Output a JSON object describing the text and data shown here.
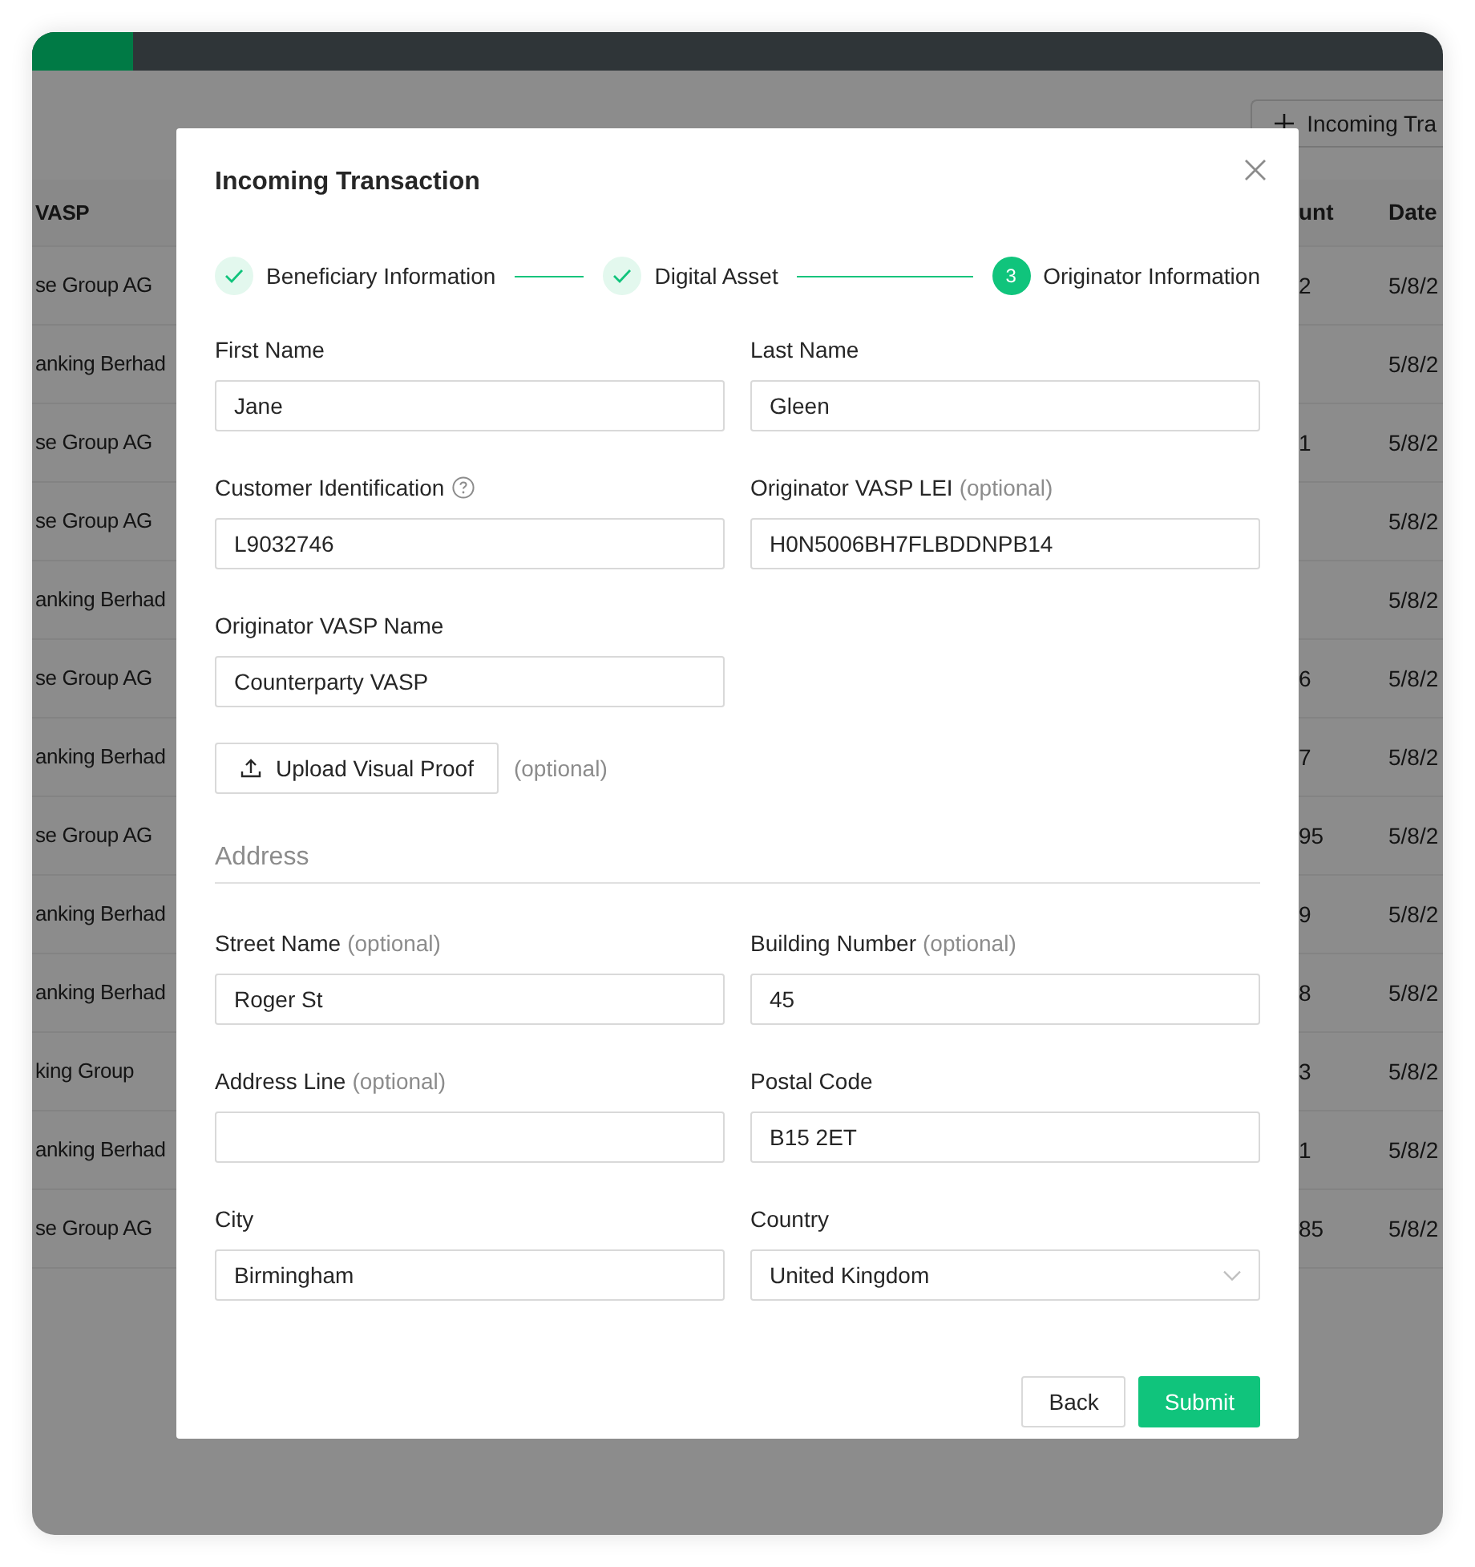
{
  "background": {
    "top_button": {
      "label": "Incoming Tra"
    },
    "columns": [
      "VASP",
      "unt",
      "Date"
    ],
    "rows": [
      {
        "column_1": "se Group AG",
        "column_2": "2",
        "column_3": "5/8/2"
      },
      {
        "column_1": "anking Berhad",
        "column_3": "5/8/2"
      },
      {
        "column_1": "se Group AG",
        "column_2": "1",
        "column_3": "5/8/2"
      },
      {
        "column_1": "se Group AG",
        "column_3": "5/8/2"
      },
      {
        "column_1": "anking Berhad",
        "column_3": "5/8/2"
      },
      {
        "column_1": "se Group AG",
        "column_2": "6",
        "column_3": "5/8/2"
      },
      {
        "column_1": "anking Berhad",
        "column_2": "7",
        "column_3": "5/8/2"
      },
      {
        "column_1": "se Group AG",
        "column_2": "95",
        "column_3": "5/8/2"
      },
      {
        "column_1": "anking Berhad",
        "column_2": "9",
        "column_3": "5/8/2"
      },
      {
        "column_1": "anking Berhad",
        "column_2": "8",
        "column_3": "5/8/2"
      },
      {
        "column_1": "king Group",
        "column_2": "3",
        "column_3": "5/8/2"
      },
      {
        "column_1": "anking Berhad",
        "column_2": "1",
        "column_3": "5/8/2"
      },
      {
        "column_1": "se Group AG",
        "column_2": "85",
        "column_3": "5/8/2"
      }
    ]
  },
  "dialog": {
    "title": "Incoming Transaction",
    "steps": [
      {
        "label": "Beneficiary Information",
        "kind": "completed"
      },
      {
        "label": "Digital Asset",
        "kind": "completed"
      },
      {
        "label": "Originator Information",
        "kind": "current",
        "number": "3"
      }
    ],
    "fields": [
      {
        "label": "First Name",
        "value": "Jane",
        "kind": "text"
      },
      {
        "label": "Last Name",
        "value": "Gleen",
        "kind": "text"
      },
      {
        "label": "Customer Identification",
        "help": true,
        "value": "L9032746",
        "kind": "text"
      },
      {
        "label": "Originator VASP LEI",
        "hint": "(optional)",
        "value": "H0N5006BH7FLBDDNPB14",
        "kind": "text"
      },
      {
        "label": "Originator VASP Name",
        "value": "Counterparty VASP",
        "kind": "text"
      }
    ],
    "upload": {
      "label": "Upload Visual Proof",
      "hint": "(optional)"
    },
    "address": {
      "heading": "Address",
      "fields": [
        {
          "label": "Street Name",
          "hint": "(optional)",
          "value": "Roger St",
          "kind": "text"
        },
        {
          "label": "Building Number",
          "hint": "(optional)",
          "value": "45",
          "kind": "text"
        },
        {
          "label": "Address Line",
          "hint": "(optional)",
          "kind": "text"
        },
        {
          "label": "Postal Code",
          "value": "B15 2ET",
          "kind": "text"
        },
        {
          "label": "City",
          "value": "Birmingham",
          "kind": "text"
        },
        {
          "label": "Country",
          "value": "United Kingdom",
          "kind": "select"
        }
      ]
    },
    "buttons": {
      "back": "Back",
      "submit": "Submit"
    }
  }
}
